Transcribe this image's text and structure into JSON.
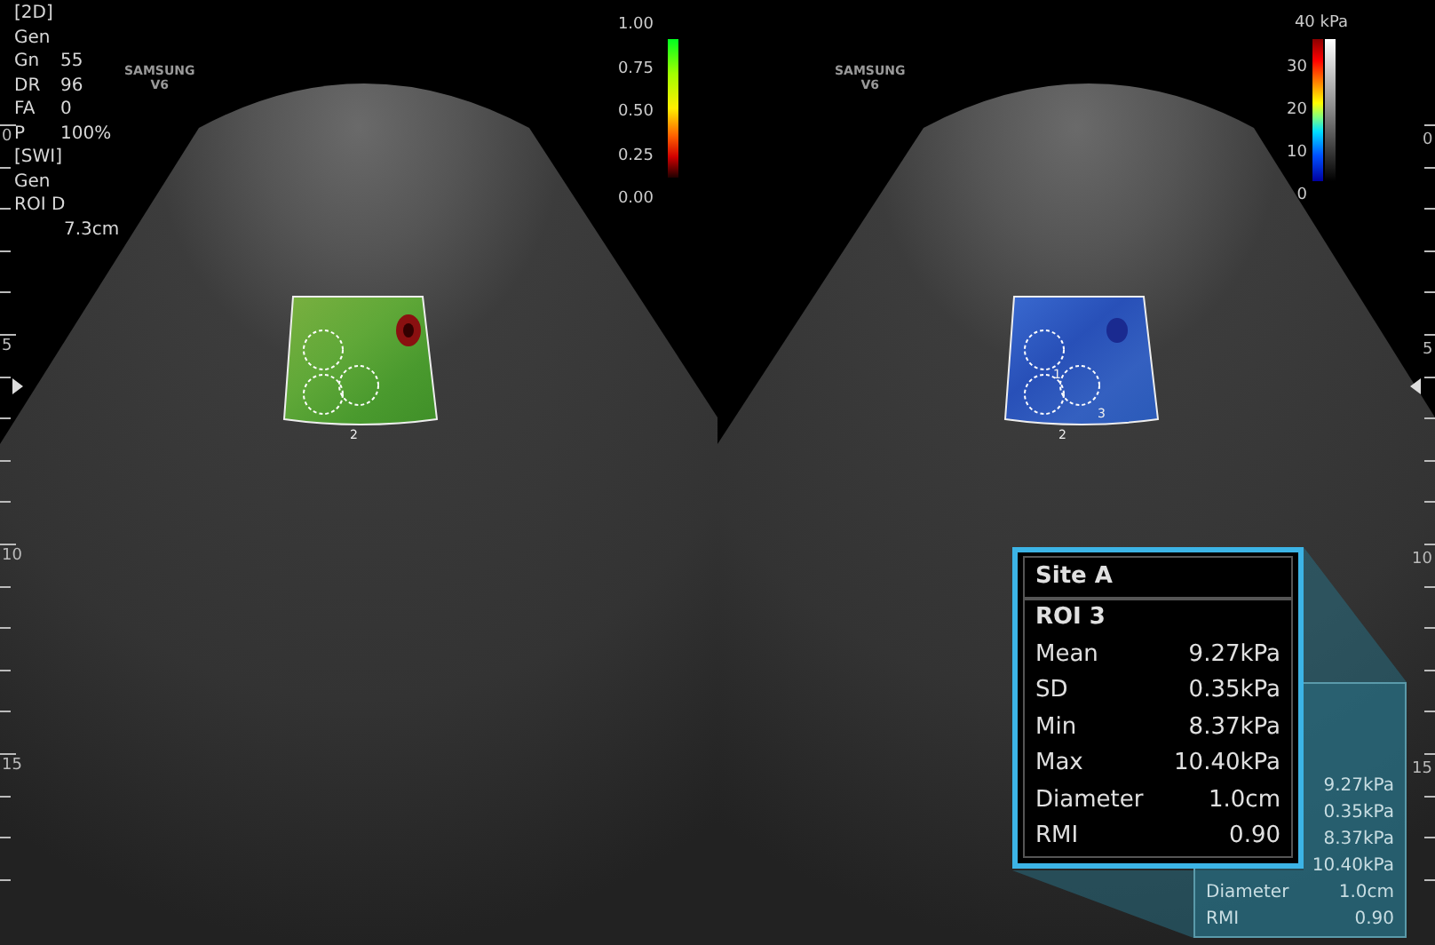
{
  "left_panel": {
    "mode": "[2D]",
    "preset": "Gen",
    "parameters": [
      {
        "label": "Gn",
        "value": "55"
      },
      {
        "label": "DR",
        "value": "96"
      },
      {
        "label": "FA",
        "value": "0"
      },
      {
        "label": "P",
        "value": "100%"
      }
    ],
    "swi_mode": "[SWI]",
    "swi_preset": "Gen",
    "roi_depth": {
      "label": "ROI D",
      "value": "7.3cm"
    },
    "logo": {
      "brand": "SAMSUNG",
      "model": "V6"
    },
    "scale_labels": [
      "0",
      "5",
      "10",
      "15"
    ],
    "colorbar": {
      "labels": [
        "1.00",
        "0.75",
        "0.50",
        "0.25",
        "0.00"
      ]
    },
    "roi_labels": [
      "2"
    ]
  },
  "right_panel": {
    "logo": {
      "brand": "SAMSUNG",
      "model": "V6"
    },
    "scale_labels": [
      "0",
      "5",
      "10",
      "15"
    ],
    "colorbar": {
      "unit_label": "40 kPa",
      "labels": [
        "30",
        "20",
        "10",
        "0"
      ]
    },
    "roi_labels": [
      "1",
      "2",
      "3"
    ],
    "measurement_popup": {
      "title": "Site A",
      "roi": "ROI 3",
      "rows": [
        {
          "label": "Mean",
          "value": "9.27kPa"
        },
        {
          "label": "SD",
          "value": "0.35kPa"
        },
        {
          "label": "Min",
          "value": "8.37kPa"
        },
        {
          "label": "Max",
          "value": "10.40kPa"
        },
        {
          "label": "Diameter",
          "value": "1.0cm"
        },
        {
          "label": "RMI",
          "value": "0.90"
        }
      ]
    },
    "background_table": {
      "rows": [
        {
          "value": "9.27kPa"
        },
        {
          "value": "0.35kPa"
        },
        {
          "value": "8.37kPa"
        },
        {
          "value": "10.40kPa"
        },
        {
          "label": "Diameter",
          "value": "1.0cm"
        },
        {
          "label": "RMI",
          "value": "0.90"
        }
      ]
    }
  }
}
